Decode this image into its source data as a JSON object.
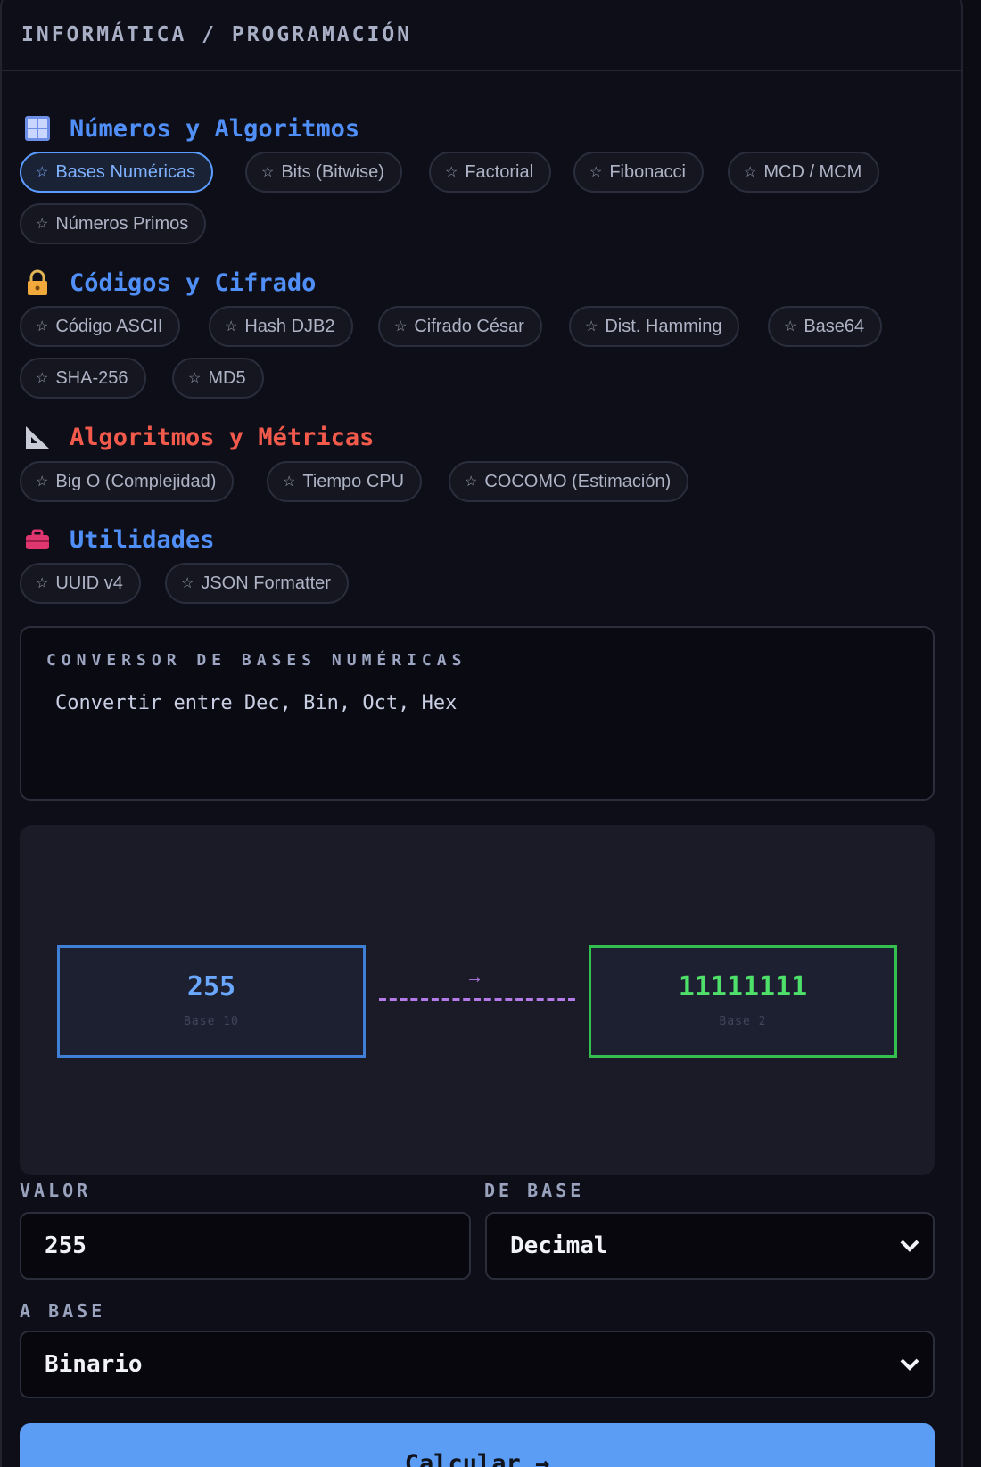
{
  "header": {
    "breadcrumb": "INFORMÁTICA / PROGRAMACIÓN"
  },
  "sections": [
    {
      "title": "Números y Algoritmos",
      "icon": "numbers-icon",
      "chips": [
        "Bases Numéricas",
        "Bits (Bitwise)",
        "Factorial",
        "Fibonacci",
        "MCD / MCM",
        "Números Primos"
      ],
      "active": "Bases Numéricas"
    },
    {
      "title": "Códigos y Cifrado",
      "icon": "lock-icon",
      "chips": [
        "Código ASCII",
        "Hash DJB2",
        "Cifrado César",
        "Dist. Hamming",
        "Base64",
        "SHA-256",
        "MD5"
      ]
    },
    {
      "title": "Algoritmos y Métricas",
      "icon": "ruler-triangle-icon",
      "chips": [
        "Big O (Complejidad)",
        "Tiempo CPU",
        "COCOMO (Estimación)"
      ]
    },
    {
      "title": "Utilidades",
      "icon": "toolbox-icon",
      "chips": [
        "UUID v4",
        "JSON Formatter"
      ]
    }
  ],
  "chip_star": "☆",
  "tool": {
    "label": "CONVERSOR DE BASES NUMÉRICAS",
    "description": "Convertir entre Dec, Bin, Oct, Hex"
  },
  "visual": {
    "input_value": "255",
    "input_base": "Base 10",
    "arrow": "→",
    "output_value": "11111111",
    "output_base": "Base 2"
  },
  "form": {
    "valor_label": "VALOR",
    "valor_value": "255",
    "de_base_label": "DE BASE",
    "de_base_value": "Decimal",
    "a_base_label": "A BASE",
    "a_base_value": "Binario",
    "submit_label": "Calcular →"
  },
  "colors": {
    "accent": "#5b9cf5",
    "section_blue": "#4f8ff7",
    "section_red": "#f25a4c",
    "output_green": "#4ee06a",
    "dash_purple": "#b37ae8"
  }
}
